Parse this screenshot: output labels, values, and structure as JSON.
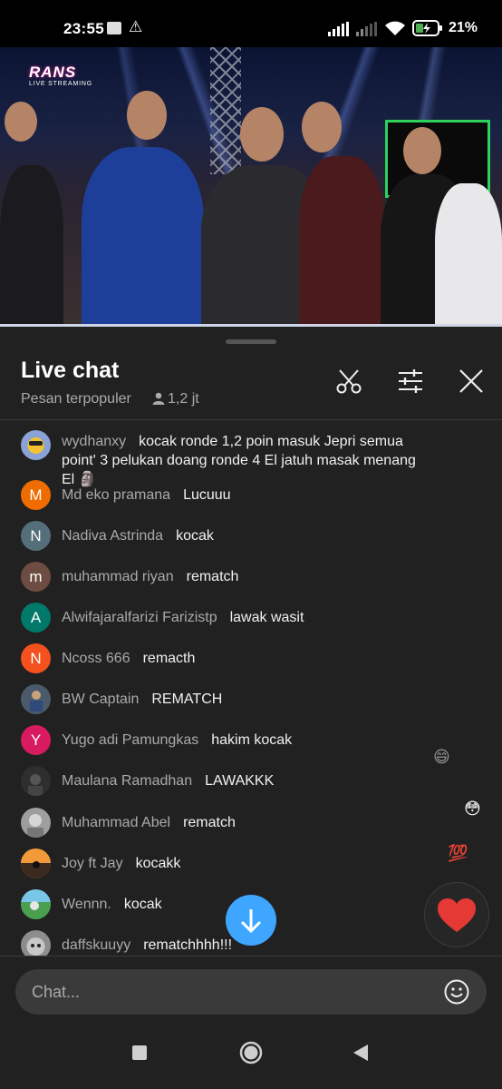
{
  "status_bar": {
    "time": "23:55",
    "battery_percent": "21%",
    "icons": [
      "gallery-icon",
      "warning-icon",
      "signal-icon",
      "signal-icon",
      "wifi-icon",
      "battery-charging-icon"
    ]
  },
  "video": {
    "logo_text": "RANS",
    "logo_subtext": "LIVE STREAMING"
  },
  "chat_header": {
    "title": "Live chat",
    "subtitle": "Pesan terpopuler",
    "viewer_count": "1,2 jt",
    "icons": [
      "scissors-icon",
      "filter-sliders-icon",
      "close-icon"
    ]
  },
  "messages": [
    {
      "author": "wydhanxy",
      "text": "kocak ronde 1,2 poin masuk Jepri semua point' 3 pelukan doang ronde 4 El jatuh masak menang El 🗿",
      "avatar_letter": "",
      "avatar_color": "#8aa2d6"
    },
    {
      "author": "Md eko pramana",
      "text": "Lucuuu",
      "avatar_letter": "M",
      "avatar_color": "#ef6c00"
    },
    {
      "author": "Nadiva Astrinda",
      "text": "kocak",
      "avatar_letter": "N",
      "avatar_color": "#546e7a"
    },
    {
      "author": "muhammad riyan",
      "text": "rematch",
      "avatar_letter": "m",
      "avatar_color": "#6d4c41"
    },
    {
      "author": "Alwifajaralfarizi Farizistp",
      "text": "lawak wasit",
      "avatar_letter": "A",
      "avatar_color": "#00796b"
    },
    {
      "author": "Ncoss 666",
      "text": "remacth",
      "avatar_letter": "N",
      "avatar_color": "#f4511e"
    },
    {
      "author": "BW Captain",
      "text": "REMATCH",
      "avatar_letter": "",
      "avatar_color": "#4a5a6a"
    },
    {
      "author": "Yugo adi Pamungkas",
      "text": "hakim kocak",
      "avatar_letter": "Y",
      "avatar_color": "#d81b60"
    },
    {
      "author": "Maulana Ramadhan",
      "text": "LAWAKKK",
      "avatar_letter": "",
      "avatar_color": "#2e2e2e"
    },
    {
      "author": "Muhammad Abel",
      "text": "rematch",
      "avatar_letter": "",
      "avatar_color": "#9e9e9e"
    },
    {
      "author": "Joy ft Jay",
      "text": "kocakk",
      "avatar_letter": "",
      "avatar_color": "#e07a2c"
    },
    {
      "author": "Wennn.",
      "text": "kocak",
      "avatar_letter": "",
      "avatar_color": "#3b8f4a"
    },
    {
      "author": "daffskuuyy",
      "text": "rematchhhh!!!",
      "avatar_letter": "",
      "avatar_color": "#8d8d8d"
    }
  ],
  "reactions": [
    "😄",
    "😳",
    "💯"
  ],
  "buttons": {
    "heart_icon": "heart-icon",
    "scroll_down_icon": "arrow-down-icon"
  },
  "chat_input": {
    "placeholder": "Chat...",
    "icon": "smiley-icon"
  },
  "nav_bar": {
    "icons": [
      "recents-square-icon",
      "home-circle-icon",
      "back-triangle-icon"
    ]
  },
  "colors": {
    "background": "#212121",
    "accent_blue": "#3ea6ff",
    "heart_red": "#e53935"
  }
}
